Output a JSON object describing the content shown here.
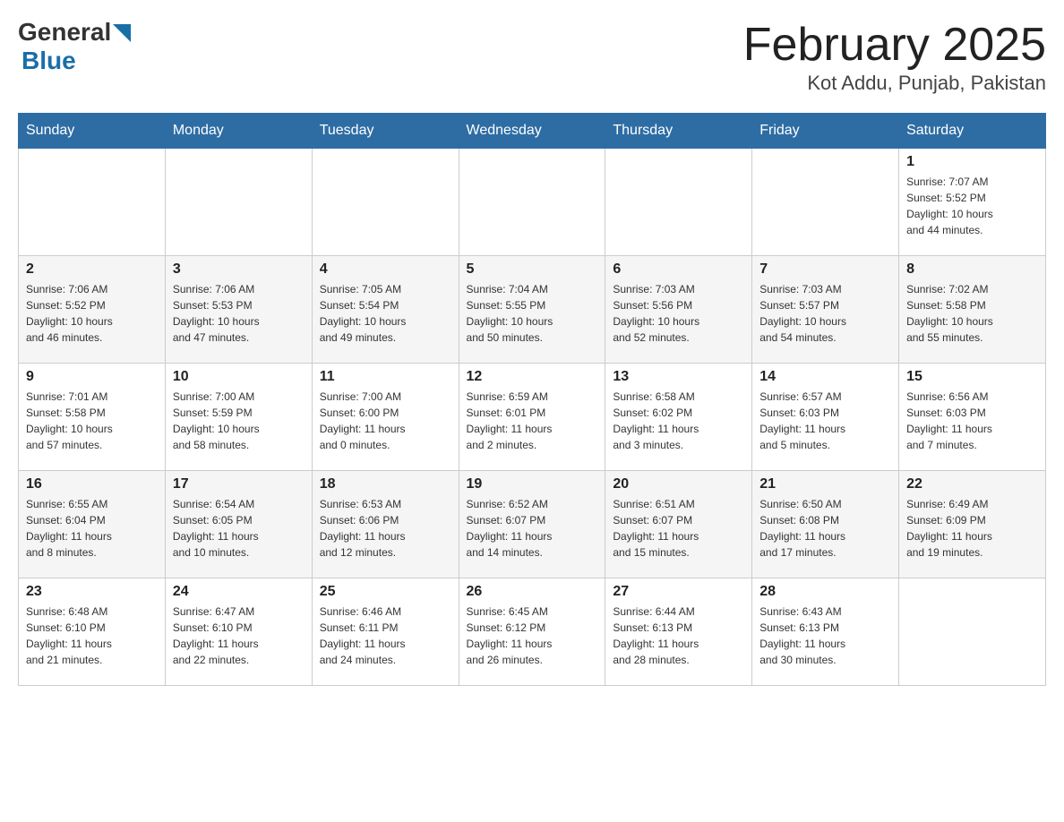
{
  "header": {
    "logo_general": "General",
    "logo_blue": "Blue",
    "title": "February 2025",
    "subtitle": "Kot Addu, Punjab, Pakistan"
  },
  "days_of_week": [
    "Sunday",
    "Monday",
    "Tuesday",
    "Wednesday",
    "Thursday",
    "Friday",
    "Saturday"
  ],
  "weeks": [
    [
      {
        "day": "",
        "info": ""
      },
      {
        "day": "",
        "info": ""
      },
      {
        "day": "",
        "info": ""
      },
      {
        "day": "",
        "info": ""
      },
      {
        "day": "",
        "info": ""
      },
      {
        "day": "",
        "info": ""
      },
      {
        "day": "1",
        "info": "Sunrise: 7:07 AM\nSunset: 5:52 PM\nDaylight: 10 hours\nand 44 minutes."
      }
    ],
    [
      {
        "day": "2",
        "info": "Sunrise: 7:06 AM\nSunset: 5:52 PM\nDaylight: 10 hours\nand 46 minutes."
      },
      {
        "day": "3",
        "info": "Sunrise: 7:06 AM\nSunset: 5:53 PM\nDaylight: 10 hours\nand 47 minutes."
      },
      {
        "day": "4",
        "info": "Sunrise: 7:05 AM\nSunset: 5:54 PM\nDaylight: 10 hours\nand 49 minutes."
      },
      {
        "day": "5",
        "info": "Sunrise: 7:04 AM\nSunset: 5:55 PM\nDaylight: 10 hours\nand 50 minutes."
      },
      {
        "day": "6",
        "info": "Sunrise: 7:03 AM\nSunset: 5:56 PM\nDaylight: 10 hours\nand 52 minutes."
      },
      {
        "day": "7",
        "info": "Sunrise: 7:03 AM\nSunset: 5:57 PM\nDaylight: 10 hours\nand 54 minutes."
      },
      {
        "day": "8",
        "info": "Sunrise: 7:02 AM\nSunset: 5:58 PM\nDaylight: 10 hours\nand 55 minutes."
      }
    ],
    [
      {
        "day": "9",
        "info": "Sunrise: 7:01 AM\nSunset: 5:58 PM\nDaylight: 10 hours\nand 57 minutes."
      },
      {
        "day": "10",
        "info": "Sunrise: 7:00 AM\nSunset: 5:59 PM\nDaylight: 10 hours\nand 58 minutes."
      },
      {
        "day": "11",
        "info": "Sunrise: 7:00 AM\nSunset: 6:00 PM\nDaylight: 11 hours\nand 0 minutes."
      },
      {
        "day": "12",
        "info": "Sunrise: 6:59 AM\nSunset: 6:01 PM\nDaylight: 11 hours\nand 2 minutes."
      },
      {
        "day": "13",
        "info": "Sunrise: 6:58 AM\nSunset: 6:02 PM\nDaylight: 11 hours\nand 3 minutes."
      },
      {
        "day": "14",
        "info": "Sunrise: 6:57 AM\nSunset: 6:03 PM\nDaylight: 11 hours\nand 5 minutes."
      },
      {
        "day": "15",
        "info": "Sunrise: 6:56 AM\nSunset: 6:03 PM\nDaylight: 11 hours\nand 7 minutes."
      }
    ],
    [
      {
        "day": "16",
        "info": "Sunrise: 6:55 AM\nSunset: 6:04 PM\nDaylight: 11 hours\nand 8 minutes."
      },
      {
        "day": "17",
        "info": "Sunrise: 6:54 AM\nSunset: 6:05 PM\nDaylight: 11 hours\nand 10 minutes."
      },
      {
        "day": "18",
        "info": "Sunrise: 6:53 AM\nSunset: 6:06 PM\nDaylight: 11 hours\nand 12 minutes."
      },
      {
        "day": "19",
        "info": "Sunrise: 6:52 AM\nSunset: 6:07 PM\nDaylight: 11 hours\nand 14 minutes."
      },
      {
        "day": "20",
        "info": "Sunrise: 6:51 AM\nSunset: 6:07 PM\nDaylight: 11 hours\nand 15 minutes."
      },
      {
        "day": "21",
        "info": "Sunrise: 6:50 AM\nSunset: 6:08 PM\nDaylight: 11 hours\nand 17 minutes."
      },
      {
        "day": "22",
        "info": "Sunrise: 6:49 AM\nSunset: 6:09 PM\nDaylight: 11 hours\nand 19 minutes."
      }
    ],
    [
      {
        "day": "23",
        "info": "Sunrise: 6:48 AM\nSunset: 6:10 PM\nDaylight: 11 hours\nand 21 minutes."
      },
      {
        "day": "24",
        "info": "Sunrise: 6:47 AM\nSunset: 6:10 PM\nDaylight: 11 hours\nand 22 minutes."
      },
      {
        "day": "25",
        "info": "Sunrise: 6:46 AM\nSunset: 6:11 PM\nDaylight: 11 hours\nand 24 minutes."
      },
      {
        "day": "26",
        "info": "Sunrise: 6:45 AM\nSunset: 6:12 PM\nDaylight: 11 hours\nand 26 minutes."
      },
      {
        "day": "27",
        "info": "Sunrise: 6:44 AM\nSunset: 6:13 PM\nDaylight: 11 hours\nand 28 minutes."
      },
      {
        "day": "28",
        "info": "Sunrise: 6:43 AM\nSunset: 6:13 PM\nDaylight: 11 hours\nand 30 minutes."
      },
      {
        "day": "",
        "info": ""
      }
    ]
  ]
}
